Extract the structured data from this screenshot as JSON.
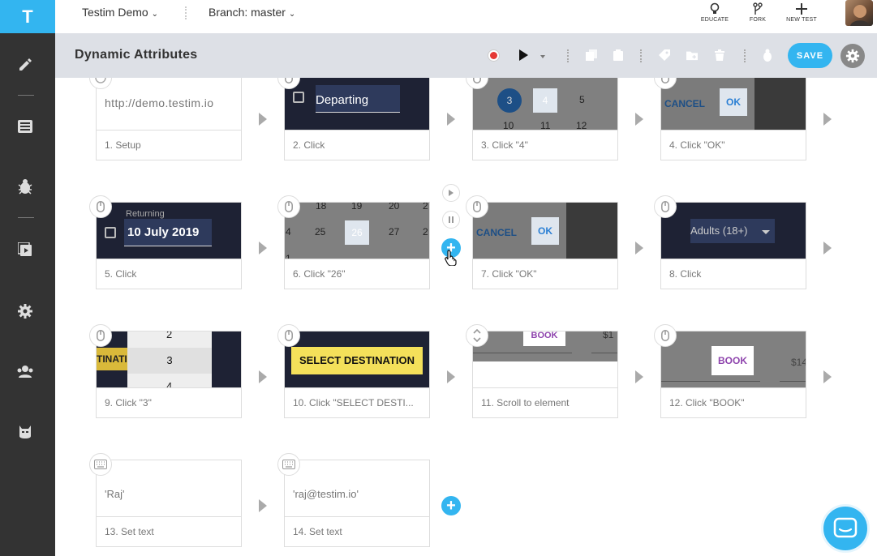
{
  "app": {
    "logo": "T",
    "project": "Testim Demo",
    "branch": "Branch: master"
  },
  "topnav": {
    "educate": "EDUCATE",
    "fork": "FORK",
    "new_test": "NEW TEST"
  },
  "test": {
    "title": "Dynamic Attributes",
    "save_label": "SAVE"
  },
  "colors": {
    "accent": "#33b5f0",
    "sidebar": "#333333",
    "toolbar": "#dde0e6",
    "record": "#e53935"
  },
  "steps": [
    {
      "label": "1. Setup",
      "preview_text": "http://demo.testim.io",
      "icon": "setup-icon"
    },
    {
      "label": "2. Click",
      "preview_text": "Departing",
      "icon": "mouse-icon"
    },
    {
      "label": "3. Click \"4\"",
      "preview_text": "4",
      "icon": "mouse-icon"
    },
    {
      "label": "4. Click \"OK\"",
      "preview_text": "OK",
      "icon": "mouse-icon"
    },
    {
      "label": "5. Click",
      "preview_text": "10 July 2019",
      "icon": "mouse-icon"
    },
    {
      "label": "6. Click \"26\"",
      "preview_text": "26",
      "icon": "mouse-icon"
    },
    {
      "label": "7. Click \"OK\"",
      "preview_text": "OK",
      "icon": "mouse-icon"
    },
    {
      "label": "8. Click",
      "preview_text": "Adults (18+)",
      "icon": "mouse-icon"
    },
    {
      "label": "9. Click \"3\"",
      "preview_text": "3",
      "icon": "mouse-icon"
    },
    {
      "label": "10. Click \"SELECT DESTI...",
      "preview_text": "SELECT DESTINATION",
      "icon": "mouse-icon"
    },
    {
      "label": "11. Scroll to element",
      "preview_text": "BOOK",
      "icon": "scroll-icon"
    },
    {
      "label": "12. Click \"BOOK\"",
      "preview_text": "BOOK",
      "icon": "mouse-icon"
    },
    {
      "label": "13. Set text",
      "preview_text": "'Raj'",
      "icon": "keyboard-icon"
    },
    {
      "label": "14. Set text",
      "preview_text": "'raj@testim.io'",
      "icon": "keyboard-icon"
    }
  ],
  "previews": {
    "returning": "Returning",
    "cancel": "CANCEL",
    "cal3": [
      "3",
      "5",
      "10",
      "11",
      "12"
    ],
    "cal6": [
      "18",
      "19",
      "20",
      "2",
      "4",
      "25",
      "27",
      "2",
      "1"
    ],
    "list9": [
      "2",
      "4"
    ],
    "tinat": "TINATI",
    "s1": "$1",
    "s14": "$14"
  }
}
